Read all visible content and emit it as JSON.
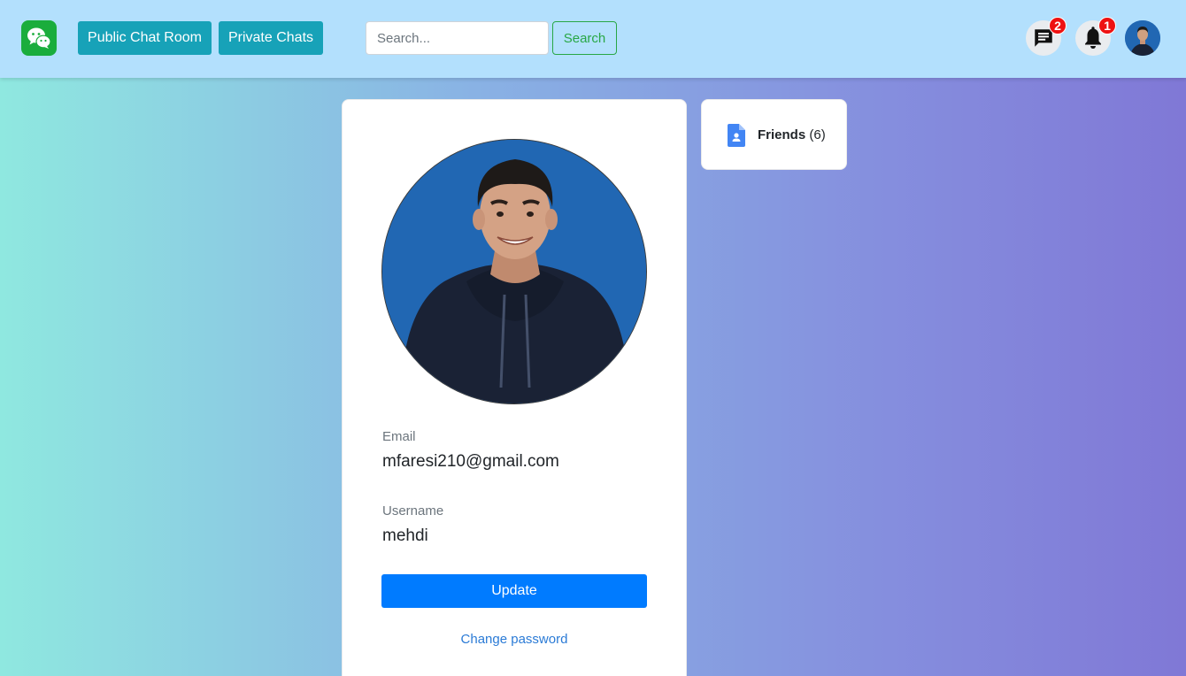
{
  "navbar": {
    "logo_icon": "wechat-logo-icon",
    "public_chat_label": "Public Chat Room",
    "private_chats_label": "Private Chats",
    "search": {
      "placeholder": "Search...",
      "value": "",
      "button_label": "Search"
    },
    "messages": {
      "icon": "message-icon",
      "badge": "2"
    },
    "notifications": {
      "icon": "bell-icon",
      "badge": "1"
    },
    "avatar_icon": "user-avatar"
  },
  "profile": {
    "photo_icon": "profile-photo",
    "email_label": "Email",
    "email_value": "mfaresi210@gmail.com",
    "username_label": "Username",
    "username_value": "mehdi",
    "update_label": "Update",
    "change_password_label": "Change password"
  },
  "friends": {
    "icon": "contact-card-icon",
    "label": "Friends",
    "count": "(6)"
  },
  "colors": {
    "navbar_bg": "#b3e0fd",
    "nav_button": "#17a2b8",
    "search_button": "#28a745",
    "primary": "#007bff",
    "badge": "#ee1111",
    "logo": "#1aad3c",
    "gradient_start": "#8fe8e0",
    "gradient_end": "#8078d6"
  }
}
